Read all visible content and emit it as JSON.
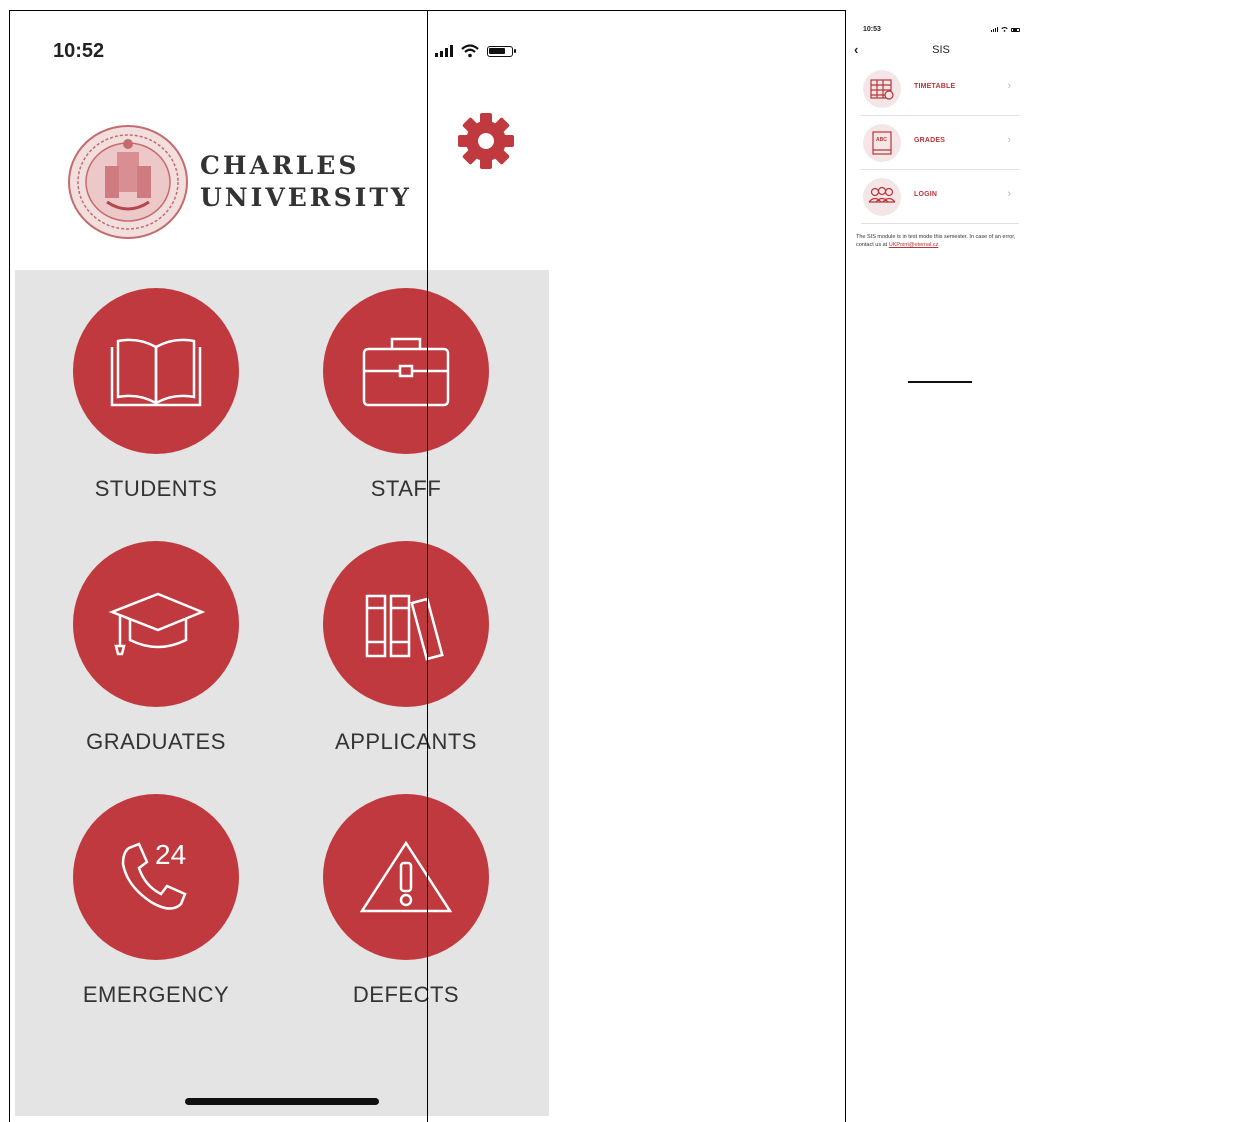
{
  "phone_home": {
    "status_time": "10:52",
    "logo": {
      "line1": "CHARLES",
      "line2": "UNIVERSITY"
    },
    "settings_icon": "gear-icon",
    "tiles": [
      {
        "label": "STUDENTS",
        "icon": "book-icon"
      },
      {
        "label": "STAFF",
        "icon": "briefcase-icon"
      },
      {
        "label": "GRADUATES",
        "icon": "graduation-cap-icon"
      },
      {
        "label": "APPLICANTS",
        "icon": "books-icon"
      },
      {
        "label": "EMERGENCY",
        "icon": "phone-24-icon"
      },
      {
        "label": "DEFECTS",
        "icon": "warning-icon"
      }
    ],
    "accent_color": "#c0393f",
    "grid_background": "#e4e4e4"
  },
  "phone_sis": {
    "status_time": "10:53",
    "back_icon": "chevron-left-icon",
    "title": "SIS",
    "menu": [
      {
        "label": "TIMETABLE",
        "icon": "calendar-icon"
      },
      {
        "label": "GRADES",
        "icon": "abc-book-icon"
      },
      {
        "label": "LOGIN",
        "icon": "users-icon"
      }
    ],
    "note_text": "The SIS module is in test mode this semester. In case of an error, contact us at ",
    "note_link": "UKPoint@eternal.cz",
    "accent_color": "#b8353b"
  }
}
